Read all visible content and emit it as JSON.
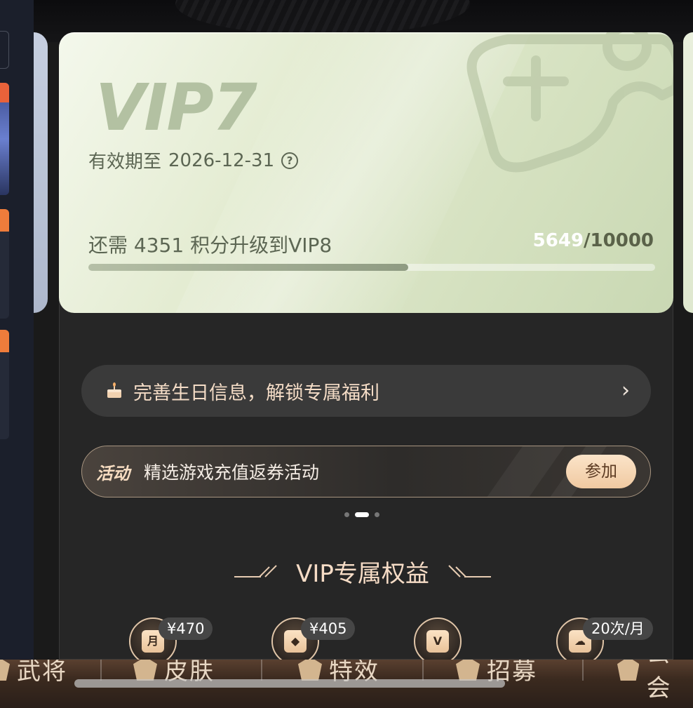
{
  "vip_card": {
    "level": "VIP7",
    "expiry_label": "有效期至",
    "expiry_date": "2026-12-31",
    "help_icon": "?",
    "upgrade_prefix": "还需",
    "points_needed": "4351",
    "upgrade_suffix": "积分升级到VIP8",
    "points_current": "5649",
    "points_total": "/10000",
    "progress": 0.5649
  },
  "birthday": {
    "icon": "cake-icon",
    "text": "完善生日信息，解锁专属福利",
    "chevron": "›"
  },
  "activity": {
    "tag": "活动",
    "text": "精选游戏充值返券活动",
    "button": "参加"
  },
  "pager": {
    "count": 3,
    "active_index": 1
  },
  "section": {
    "title": "VIP专属权益"
  },
  "benefits": [
    {
      "icon": "ticket-month-icon",
      "glyph": "月",
      "badge": "¥470"
    },
    {
      "icon": "ticket-diamond-icon",
      "glyph": "◆",
      "badge": "¥405"
    },
    {
      "icon": "vip-gift-icon",
      "glyph": "V",
      "badge": ""
    },
    {
      "icon": "cloud-upload-icon",
      "glyph": "☁",
      "badge": "20次/月"
    }
  ],
  "bottom_nav": [
    {
      "label": "武将"
    },
    {
      "label": "皮肤"
    },
    {
      "label": "特效"
    },
    {
      "label": "招募"
    },
    {
      "label": "公会"
    }
  ],
  "colors": {
    "accent": "#f6dcc6",
    "card_green": "#d5e1c0",
    "panel": "#262626"
  }
}
